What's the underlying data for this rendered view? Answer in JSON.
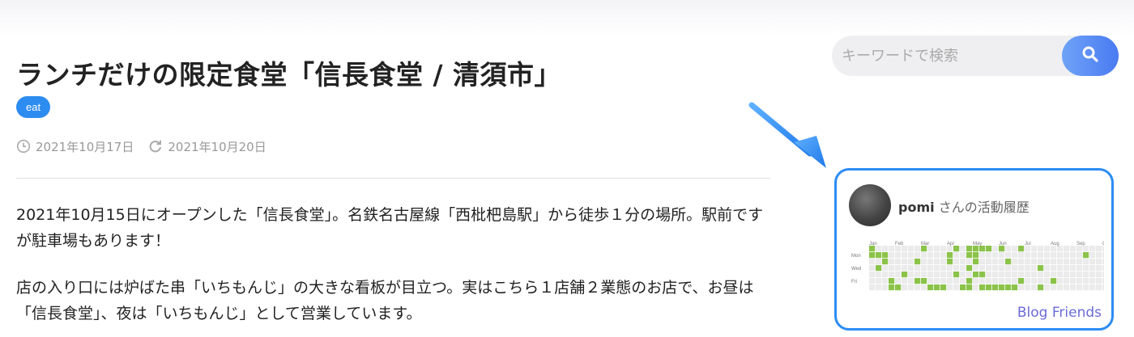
{
  "article": {
    "title": "ランチだけの限定食堂「信長食堂 / 清須市」",
    "tag": "eat",
    "published": "2021年10月17日",
    "updated": "2021年10月20日",
    "paragraphs": [
      "2021年10月15日にオープンした「信長食堂」。名鉄名古屋線「西枇杷島駅」から徒歩１分の場所。駅前ですが駐車場もあります！",
      "店の入り口には炉ばた串「いちもんじ」の大きな看板が目立つ。実はこちら１店舗２業態のお店で、お昼は「信長食堂」、夜は「いちもんじ」として営業しています。"
    ]
  },
  "search": {
    "placeholder": "キーワードで検索"
  },
  "widget": {
    "username": "pomi",
    "suffix": "さんの活動履歴",
    "months": [
      "Jan",
      "Feb",
      "Mar",
      "Apr",
      "May",
      "Jun",
      "Jul",
      "Aug",
      "Sep",
      "Oct"
    ],
    "days": [
      "Mon",
      "Wed",
      "Fri"
    ],
    "active_cells": [
      [
        0,
        0
      ],
      [
        0,
        1
      ],
      [
        1,
        1
      ],
      [
        1,
        3
      ],
      [
        2,
        1
      ],
      [
        2,
        2
      ],
      [
        3,
        5
      ],
      [
        3,
        6
      ],
      [
        4,
        6
      ],
      [
        5,
        4
      ],
      [
        7,
        2
      ],
      [
        7,
        5
      ],
      [
        8,
        0
      ],
      [
        8,
        5
      ],
      [
        9,
        6
      ],
      [
        10,
        6
      ],
      [
        11,
        6
      ],
      [
        12,
        1
      ],
      [
        12,
        2
      ],
      [
        13,
        0
      ],
      [
        13,
        4
      ],
      [
        14,
        6
      ],
      [
        15,
        0
      ],
      [
        15,
        1
      ],
      [
        15,
        3
      ],
      [
        15,
        5
      ],
      [
        15,
        6
      ],
      [
        16,
        0
      ],
      [
        16,
        1
      ],
      [
        16,
        2
      ],
      [
        16,
        4
      ],
      [
        17,
        0
      ],
      [
        17,
        4
      ],
      [
        17,
        6
      ],
      [
        18,
        0
      ],
      [
        18,
        6
      ],
      [
        19,
        6
      ],
      [
        20,
        0
      ],
      [
        20,
        6
      ],
      [
        21,
        2
      ],
      [
        21,
        6
      ],
      [
        22,
        6
      ],
      [
        23,
        0
      ],
      [
        23,
        5
      ],
      [
        26,
        3
      ],
      [
        26,
        6
      ],
      [
        28,
        5
      ],
      [
        33,
        1
      ],
      [
        37,
        0
      ],
      [
        37,
        2
      ],
      [
        38,
        0
      ],
      [
        38,
        6
      ],
      [
        39,
        1
      ]
    ],
    "footer_link": "Blog Friends"
  },
  "colors": {
    "accent": "#2d8cf0",
    "highlight_border": "#2c8cf4",
    "heat_empty": "#ebebeb",
    "heat_active": "#8bc34a",
    "link": "#6b6bd6"
  }
}
